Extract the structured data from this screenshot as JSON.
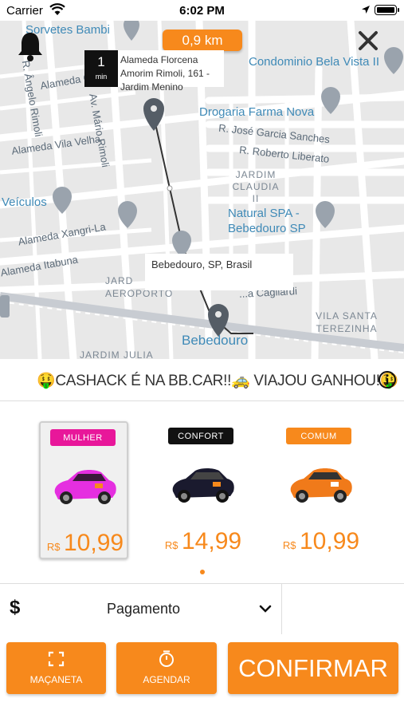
{
  "status_bar": {
    "carrier": "Carrier",
    "time": "6:02 PM"
  },
  "map": {
    "distance": "0,9 km",
    "eta": {
      "value": "1",
      "unit": "min"
    },
    "origin_address": "Alameda Florcena Amorim Rimoli, 161 - Jardim Menino",
    "destination_address": "Bebedouro, SP, Brasil",
    "labels": {
      "sorvetes": "Sorvetes Bambi",
      "condominio": "Condominio Bela Vista II",
      "drogaria": "Drogaria Farma Nova",
      "rua_jose": "R. José Garcia Sanches",
      "rua_roberto": "R. Roberto Liberato",
      "jardim_claudia": "JARDIM CLAUDIA II",
      "natural_spa": "Natural SPA - Bebedouro SP",
      "veiculos": "Veículos",
      "alameda_vila_velha": "Alameda Vila Velha",
      "alameda_xangri": "Alameda Xangri-La",
      "alameda_itabuna": "Alameda Itabuna",
      "alameda_ce": "Alameda Ce",
      "r_angelo": "R. Ângelo Rimoli",
      "av_mario": "Av. Mário Rimoli",
      "aeroporto": "JARD AEROPORTO",
      "vila_santa": "VILA SANTA TEREZINHA",
      "cagliardi": "...a Cagliardi",
      "bebedouro": "Bebedouro",
      "jardim_julia": "JARDIM JULIA"
    }
  },
  "promo": {
    "text": "🤑CASHACK É NA BB.CAR!!🚕 VIAJOU GANHOU!🤑"
  },
  "cars": [
    {
      "category": "MULHER",
      "currency": "R$",
      "price": "10,99",
      "tag_color": "#e8179a",
      "car_color": "#e52fe0",
      "selected": true
    },
    {
      "category": "CONFORT",
      "currency": "R$",
      "price": "14,99",
      "tag_color": "#111111",
      "car_color": "#1a1a2e",
      "selected": false
    },
    {
      "category": "COMUM",
      "currency": "R$",
      "price": "10,99",
      "tag_color": "#f7891c",
      "car_color": "#f07a1a",
      "selected": false
    }
  ],
  "payment": {
    "icon": "$",
    "label": "Pagamento"
  },
  "actions": {
    "macaneta": "MAÇANETA",
    "agendar": "AGENDAR",
    "confirmar": "CONFIRMAR"
  },
  "colors": {
    "accent": "#f7891c"
  }
}
